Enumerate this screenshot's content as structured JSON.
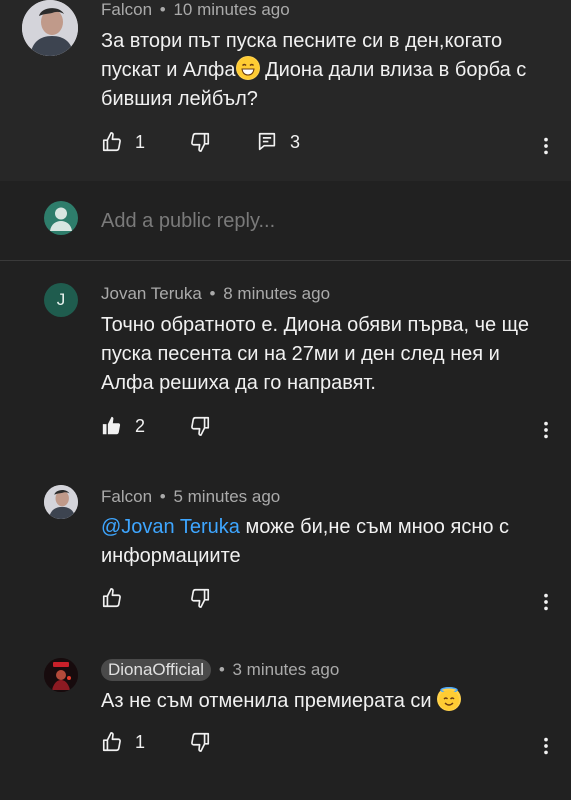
{
  "comment1": {
    "author": "Falcon",
    "time": "10 minutes ago",
    "text_part1": "За втори път пуска песните си в ден,когато пускат и Алфа",
    "text_part2": " Диона дали влиза в борба с бившия лейбъл?",
    "likes": "1",
    "replies": "3"
  },
  "reply_box": {
    "placeholder": "Add a public reply..."
  },
  "reply1": {
    "author": "Jovan Teruka",
    "avatar_letter": "J",
    "time": "8 minutes ago",
    "text": "Точно обратното е. Диона обяви първа, че ще пуска песента си на 27ми и ден след нея и Алфа решиха да го направят.",
    "likes": "2"
  },
  "reply2": {
    "author": "Falcon",
    "time": "5 minutes ago",
    "mention": "@Jovan Teruka",
    "text": " може би,не съм мноо ясно с информациите"
  },
  "reply3": {
    "author": "DionaOfficial",
    "time": "3 minutes ago",
    "text": "Аз не съм отменила премиерата си ",
    "likes": "1"
  },
  "separator": "•",
  "icons": [
    "like-icon",
    "dislike-icon",
    "reply-icon",
    "more-icon",
    "person-icon"
  ],
  "colors": {
    "background": "#212121",
    "highlight": "#272727",
    "mention": "#3ea6ff",
    "muted": "#aaaaaa",
    "placeholder_avatar": "#2e7d6b",
    "jovan_avatar": "#1f5c4e"
  }
}
